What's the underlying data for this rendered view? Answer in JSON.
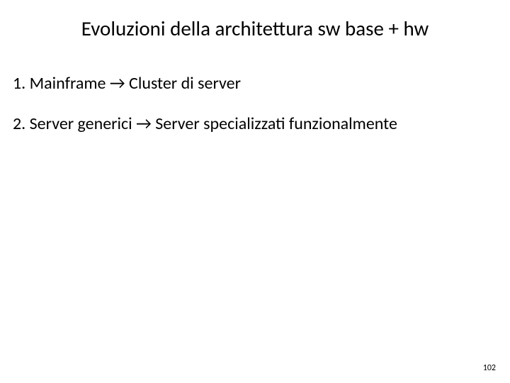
{
  "title": "Evoluzioni della architettura sw base + hw",
  "items": [
    "1. Mainframe → Cluster di server",
    "2. Server generici → Server specializzati funzionalmente"
  ],
  "page_number": "102"
}
